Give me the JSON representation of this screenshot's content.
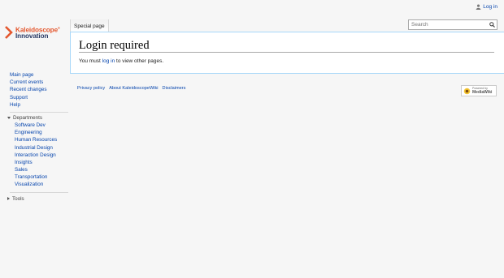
{
  "personal": {
    "login_label": "Log in"
  },
  "logo": {
    "line1": "Kaleidoscope",
    "line2": "Innovation",
    "mark": "®"
  },
  "tabs": {
    "special_page": "Special page"
  },
  "search": {
    "placeholder": "Search"
  },
  "content": {
    "title": "Login required",
    "message_before": "You must ",
    "message_link": "log in",
    "message_after": " to view other pages."
  },
  "sidebar": {
    "nav": [
      "Main page",
      "Current events",
      "Recent changes",
      "Support",
      "Help"
    ],
    "departments": {
      "heading": "Departments",
      "items": [
        "Software Dev",
        "Engineering",
        "Human Resources",
        "Industrial Design",
        "Interaction Design",
        "Insights",
        "Sales",
        "Transportation",
        "Visualization"
      ]
    },
    "tools_heading": "Tools"
  },
  "footer": {
    "links": [
      "Privacy policy",
      "About KaleidoscopeWiki",
      "Disclaimers"
    ]
  },
  "powered": {
    "line1": "Powered by",
    "line2": "MediaWiki"
  },
  "colors": {
    "link": "#0645ad",
    "logo_orange": "#e4572e",
    "logo_navy": "#2a3b66",
    "border_blue": "#a7d7f9"
  }
}
